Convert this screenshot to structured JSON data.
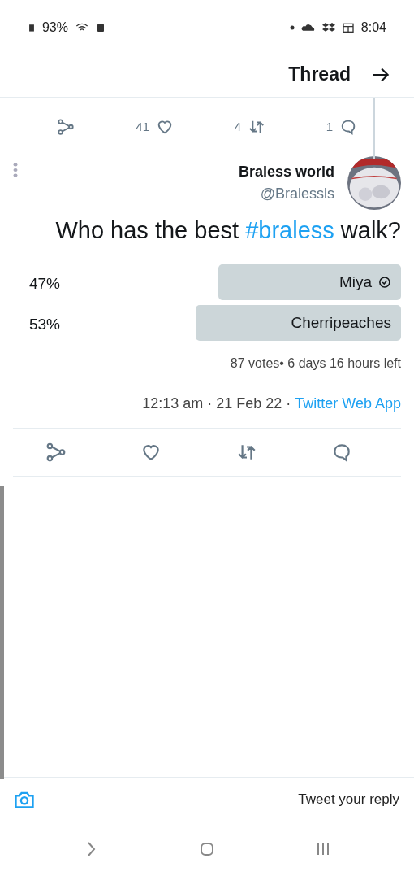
{
  "status_bar": {
    "time": "8:04",
    "battery": "93%"
  },
  "header": {
    "title": "Thread"
  },
  "previous_tweet": {
    "actions": [
      {
        "kind": "share"
      },
      {
        "kind": "like",
        "count": "41"
      },
      {
        "kind": "retweet",
        "count": "4"
      },
      {
        "kind": "reply",
        "count": "1"
      }
    ]
  },
  "tweet": {
    "author": "Braless world",
    "handle": "@Bralessls",
    "text": [
      {
        "kind": "plain",
        "text": "Who has the best "
      },
      {
        "kind": "hashtag",
        "text": "#braless"
      },
      {
        "kind": "plain",
        "text": " walk?"
      }
    ],
    "poll": {
      "options": [
        {
          "label": "Miya",
          "selected": true,
          "percent": "47%"
        },
        {
          "label": "Cherripeaches",
          "selected": false,
          "percent": "53%"
        }
      ],
      "summary": "87 votes• 6 days 16 hours left"
    },
    "timestamp": "12:13 am · 21 Feb 22 · ",
    "source": "Twitter Web App",
    "actions": [
      {
        "kind": "share"
      },
      {
        "kind": "like"
      },
      {
        "kind": "retweet"
      },
      {
        "kind": "reply"
      }
    ]
  },
  "reply_bar": {
    "placeholder": "Tweet your reply"
  }
}
